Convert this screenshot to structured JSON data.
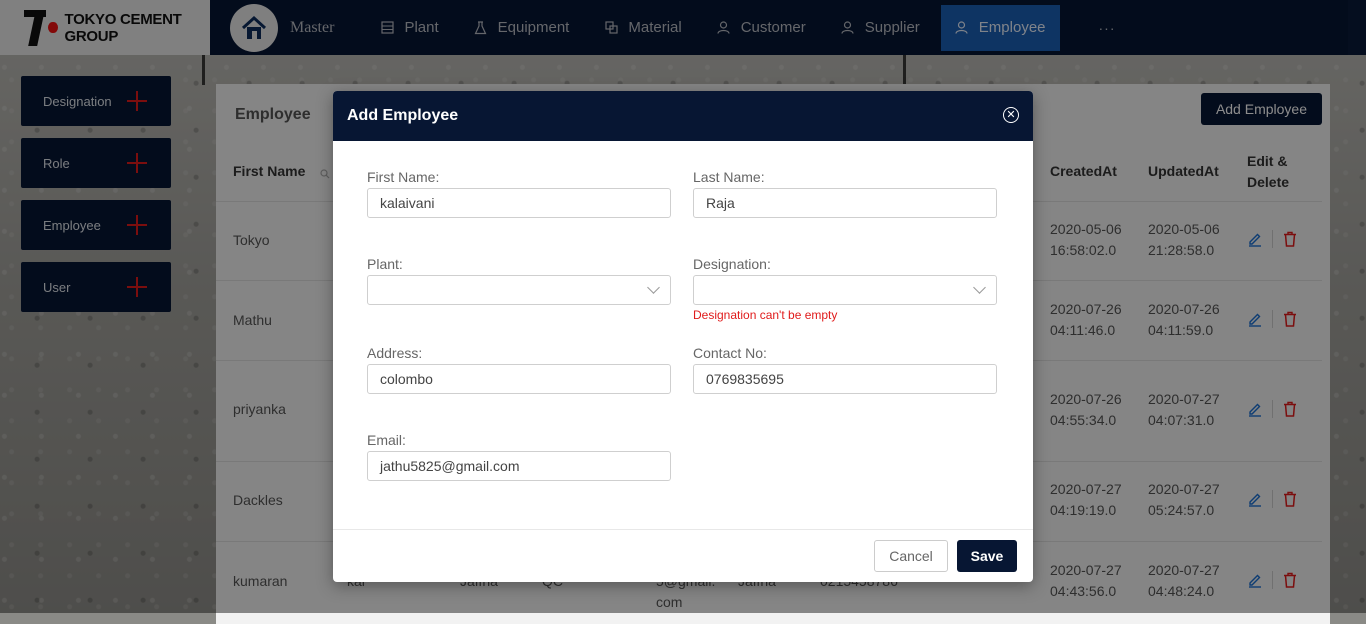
{
  "brand": {
    "logo_text": "TOKYO CEMENT GROUP",
    "master_label": "Master"
  },
  "nav": {
    "items": [
      {
        "label": "Plant",
        "icon": "building-icon"
      },
      {
        "label": "Equipment",
        "icon": "flask-icon"
      },
      {
        "label": "Material",
        "icon": "layers-icon"
      },
      {
        "label": "Customer",
        "icon": "user-icon"
      },
      {
        "label": "Supplier",
        "icon": "user-icon"
      },
      {
        "label": "Employee",
        "icon": "user-icon",
        "active": true
      }
    ],
    "more": "···"
  },
  "sidebar": {
    "items": [
      {
        "label": "Designation"
      },
      {
        "label": "Role"
      },
      {
        "label": "Employee"
      },
      {
        "label": "User"
      }
    ]
  },
  "page": {
    "title": "Employee",
    "add_button": "Add Employee",
    "columns": {
      "first_name": "First Name",
      "created_at": "CreatedAt",
      "updated_at": "UpdatedAt",
      "edit_delete_1": "Edit &",
      "edit_delete_2": "Delete"
    },
    "rows": [
      {
        "first_name": "Tokyo",
        "created_date": "2020-05-06",
        "created_time": "16:58:02.0",
        "updated_date": "2020-05-06",
        "updated_time": "21:28:58.0"
      },
      {
        "first_name": "Mathu",
        "created_date": "2020-07-26",
        "created_time": "04:11:46.0",
        "updated_date": "2020-07-26",
        "updated_time": "04:11:59.0"
      },
      {
        "first_name": "priyanka",
        "created_date": "2020-07-26",
        "created_time": "04:55:34.0",
        "updated_date": "2020-07-27",
        "updated_time": "04:07:31.0"
      },
      {
        "first_name": "Dackles",
        "created_date": "2020-07-27",
        "created_time": "04:19:19.0",
        "updated_date": "2020-07-27",
        "updated_time": "05:24:57.0"
      },
      {
        "first_name": "kumaran",
        "created_date": "2020-07-27",
        "created_time": "04:43:56.0",
        "updated_date": "2020-07-27",
        "updated_time": "04:48:24.0",
        "last_name": "kar",
        "plant": "Jaffna",
        "designation": "QC",
        "email_tail": "com",
        "email_part": "5@gmail.",
        "address": "Jaffna",
        "contact": "0215458786"
      }
    ]
  },
  "modal": {
    "title": "Add Employee",
    "first_name_label": "First Name:",
    "first_name_value": "kalaivani",
    "last_name_label": "Last Name:",
    "last_name_value": "Raja",
    "plant_label": "Plant:",
    "designation_label": "Designation:",
    "designation_error": "Designation can't be empty",
    "address_label": "Address:",
    "address_value": "colombo",
    "contact_label": "Contact No:",
    "contact_value": "0769835695",
    "email_label": "Email:",
    "email_value": "jathu5825@gmail.com",
    "cancel_label": "Cancel",
    "save_label": "Save"
  },
  "colors": {
    "navy": "#071633",
    "active_tab": "#1a5fb4",
    "error": "#e01b1b",
    "edit": "#1a6fd1",
    "delete": "#e01b1b"
  }
}
